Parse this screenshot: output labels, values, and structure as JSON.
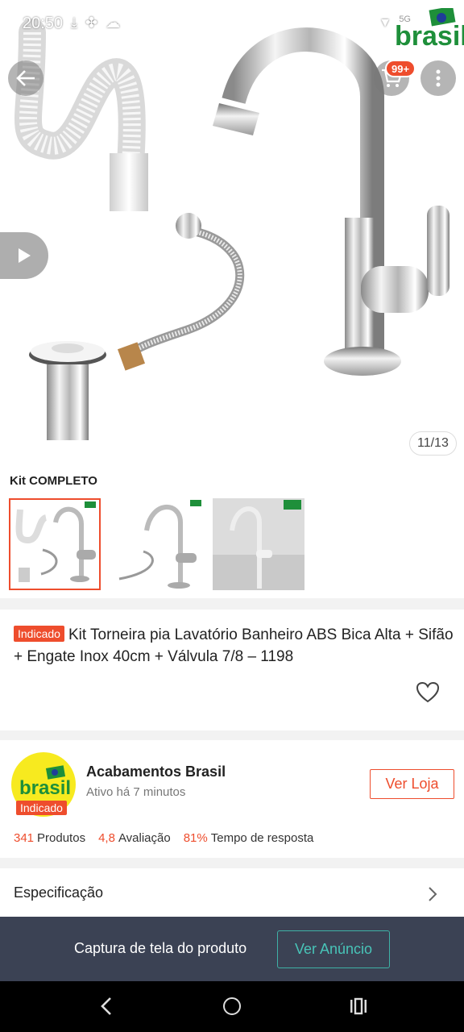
{
  "status_bar": {
    "time": "20:50",
    "network": "5G"
  },
  "hero": {
    "cart_badge": "99+",
    "image_counter": "11/13",
    "brand_text": "brasil"
  },
  "kit": {
    "label": "Kit COMPLETO",
    "thumbnails": [
      "kit-completo",
      "torneira-engate",
      "torneira-foto"
    ]
  },
  "product": {
    "tag": "Indicado",
    "title": "Kit Torneira pia Lavatório Banheiro ABS Bica Alta + Sifão + Engate Inox 40cm + Válvula 7/8 – 1198"
  },
  "shop": {
    "logo_text": "brasil",
    "tag": "Indicado",
    "name": "Acabamentos Brasil",
    "status": "Ativo há 7 minutos",
    "button": "Ver Loja",
    "stats": [
      {
        "value": "341",
        "label": "Produtos"
      },
      {
        "value": "4,8",
        "label": "Avaliação"
      },
      {
        "value": "81%",
        "label": "Tempo de resposta"
      }
    ]
  },
  "spec": {
    "label": "Especificação"
  },
  "banner": {
    "text": "Captura de tela do produto",
    "button": "Ver Anúncio"
  },
  "colors": {
    "accent": "#ee4d2d",
    "teal": "#48c4b8",
    "banner_bg": "#3b4254"
  }
}
